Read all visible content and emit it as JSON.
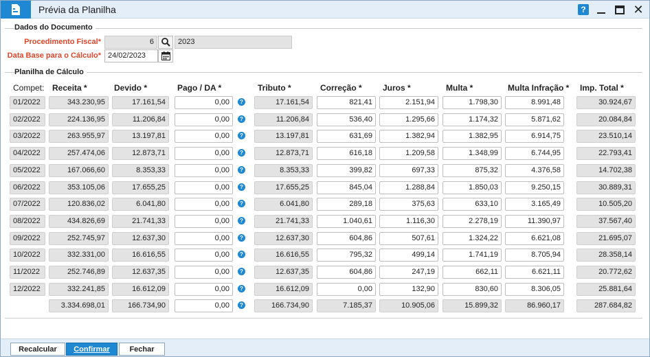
{
  "window": {
    "title": "Prévia da Planilha"
  },
  "document": {
    "section_title": "Dados do Documento",
    "procedimento_label": "Procedimento Fiscal*",
    "procedimento_number": "6",
    "procedimento_year": "2023",
    "data_base_label": "Data Base para o Cálculo*",
    "data_base_value": "24/02/2023"
  },
  "sheet": {
    "section_title": "Planilha de Cálculo",
    "headers": {
      "compet": "Compet:",
      "receita": "Receita *",
      "devido": "Devido *",
      "pago": "Pago / DA *",
      "tributo": "Tributo *",
      "correcao": "Correção *",
      "juros": "Juros *",
      "multa": "Multa *",
      "multa_infracao": "Multa Infração *",
      "imp_total": "Imp. Total *"
    },
    "rows": [
      {
        "compet": "01/2022",
        "receita": "343.230,95",
        "devido": "17.161,54",
        "pago": "0,00",
        "tributo": "17.161,54",
        "correcao": "821,41",
        "juros": "2.151,94",
        "multa": "1.798,30",
        "multa_infracao": "8.991,48",
        "imp_total": "30.924,67"
      },
      {
        "compet": "02/2022",
        "receita": "224.136,95",
        "devido": "11.206,84",
        "pago": "0,00",
        "tributo": "11.206,84",
        "correcao": "536,40",
        "juros": "1.295,66",
        "multa": "1.174,32",
        "multa_infracao": "5.871,62",
        "imp_total": "20.084,84"
      },
      {
        "compet": "03/2022",
        "receita": "263.955,97",
        "devido": "13.197,81",
        "pago": "0,00",
        "tributo": "13.197,81",
        "correcao": "631,69",
        "juros": "1.382,94",
        "multa": "1.382,95",
        "multa_infracao": "6.914,75",
        "imp_total": "23.510,14"
      },
      {
        "compet": "04/2022",
        "receita": "257.474,06",
        "devido": "12.873,71",
        "pago": "0,00",
        "tributo": "12.873,71",
        "correcao": "616,18",
        "juros": "1.209,58",
        "multa": "1.348,99",
        "multa_infracao": "6.744,95",
        "imp_total": "22.793,41"
      },
      {
        "compet": "05/2022",
        "receita": "167.066,60",
        "devido": "8.353,33",
        "pago": "0,00",
        "tributo": "8.353,33",
        "correcao": "399,82",
        "juros": "697,33",
        "multa": "875,32",
        "multa_infracao": "4.376,58",
        "imp_total": "14.702,38"
      },
      {
        "compet": "06/2022",
        "receita": "353.105,06",
        "devido": "17.655,25",
        "pago": "0,00",
        "tributo": "17.655,25",
        "correcao": "845,04",
        "juros": "1.288,84",
        "multa": "1.850,03",
        "multa_infracao": "9.250,15",
        "imp_total": "30.889,31"
      },
      {
        "compet": "07/2022",
        "receita": "120.836,02",
        "devido": "6.041,80",
        "pago": "0,00",
        "tributo": "6.041,80",
        "correcao": "289,18",
        "juros": "375,63",
        "multa": "633,10",
        "multa_infracao": "3.165,49",
        "imp_total": "10.505,20"
      },
      {
        "compet": "08/2022",
        "receita": "434.826,69",
        "devido": "21.741,33",
        "pago": "0,00",
        "tributo": "21.741,33",
        "correcao": "1.040,61",
        "juros": "1.116,30",
        "multa": "2.278,19",
        "multa_infracao": "11.390,97",
        "imp_total": "37.567,40"
      },
      {
        "compet": "09/2022",
        "receita": "252.745,97",
        "devido": "12.637,30",
        "pago": "0,00",
        "tributo": "12.637,30",
        "correcao": "604,86",
        "juros": "507,61",
        "multa": "1.324,22",
        "multa_infracao": "6.621,08",
        "imp_total": "21.695,07"
      },
      {
        "compet": "10/2022",
        "receita": "332.331,00",
        "devido": "16.616,55",
        "pago": "0,00",
        "tributo": "16.616,55",
        "correcao": "795,32",
        "juros": "499,14",
        "multa": "1.741,19",
        "multa_infracao": "8.705,94",
        "imp_total": "28.358,14"
      },
      {
        "compet": "11/2022",
        "receita": "252.746,89",
        "devido": "12.637,35",
        "pago": "0,00",
        "tributo": "12.637,35",
        "correcao": "604,86",
        "juros": "247,19",
        "multa": "662,11",
        "multa_infracao": "6.621,11",
        "imp_total": "20.772,62"
      },
      {
        "compet": "12/2022",
        "receita": "332.241,85",
        "devido": "16.612,09",
        "pago": "0,00",
        "tributo": "16.612,09",
        "correcao": "0,00",
        "juros": "132,90",
        "multa": "830,60",
        "multa_infracao": "8.306,05",
        "imp_total": "25.881,64"
      }
    ],
    "totals": {
      "receita": "3.334.698,01",
      "devido": "166.734,90",
      "pago": "0,00",
      "tributo": "166.734,90",
      "correcao": "7.185,37",
      "juros": "10.905,06",
      "multa": "15.899,32",
      "multa_infracao": "86.960,17",
      "imp_total": "287.684,82"
    }
  },
  "footer": {
    "recalcular": "Recalcular",
    "confirmar": "Confirmar",
    "fechar": "Fechar"
  },
  "icons": {
    "app": "spreadsheet-doc-icon",
    "help": "help-icon",
    "search": "search-icon",
    "calendar": "calendar-icon",
    "info": "question-icon"
  },
  "colors": {
    "accent": "#1e88d2",
    "required_label": "#e0452a",
    "readonly_bg": "#e3e3e3"
  }
}
